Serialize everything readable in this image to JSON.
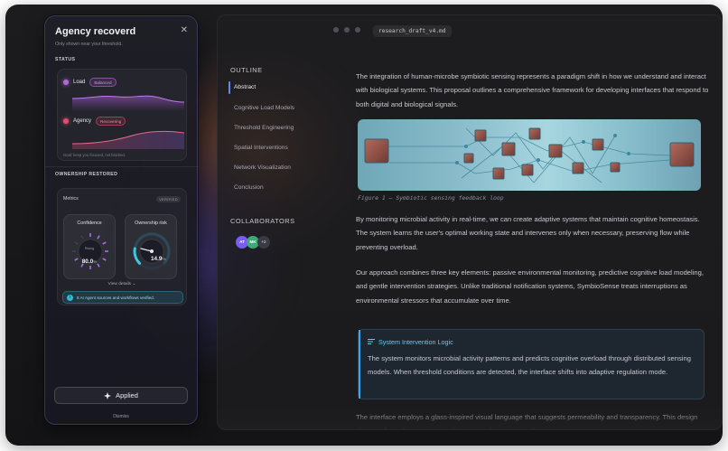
{
  "panel": {
    "title": "Agency recoverd",
    "subtitle": "Only shown near your threshold.",
    "status_label": "STATUS",
    "status": [
      {
        "name": "Load",
        "pill": "Balanced",
        "color": "#b06ad8"
      },
      {
        "name": "Agency",
        "pill": "Recovering",
        "color": "#e0506e"
      }
    ],
    "status_note": "Goal: keep you focused, not blocked.",
    "ownership_label": "OWNERSHIP RESTORED",
    "metrics_label": "Metrics",
    "verified_badge": "VERIFIED",
    "gauges": [
      {
        "title": "Confidence",
        "sub": "Rising",
        "value": "80.0",
        "unit": "%"
      },
      {
        "title": "Ownership risk",
        "value": "14.9",
        "unit": "%"
      }
    ],
    "view_details": "View details",
    "banner_text": "8 AI Agent sources and workflows verified.",
    "applied_label": "Applied",
    "dismiss_label": "Dismiss"
  },
  "window": {
    "file_tab": "research_draft_v4.md",
    "outline_title": "OUTLINE",
    "outline_items": [
      {
        "label": "Abstract"
      },
      {
        "label": "Cognitive Load Models"
      },
      {
        "label": "Threshold Engineering"
      },
      {
        "label": "Spatial Interventions"
      },
      {
        "label": "Network Visualization"
      },
      {
        "label": "Conclusion"
      }
    ],
    "collab_title": "COLLABORATORS",
    "collaborators": [
      {
        "initials": "AT",
        "color": "#7a5cf0"
      },
      {
        "initials": "MK",
        "color": "#3ea87a"
      },
      {
        "initials": "+2",
        "color": "#3a3a42"
      }
    ]
  },
  "doc": {
    "p1": "The integration of human-microbe symbiotic sensing represents a paradigm shift in how we understand and interact with biological systems. This proposal outlines a comprehensive framework for developing interfaces that respond to both digital and biological signals.",
    "caption": "Figure 1 — Symbiotic sensing feedback loop",
    "p2": "By monitoring microbial activity in real-time, we can create adaptive systems that maintain cognitive homeostasis. The system learns the user's optimal working state and intervenes only when necessary, preserving flow while preventing overload.",
    "p3": "Our approach combines three key elements: passive environmental monitoring, predictive cognitive load modeling, and gentle intervention strategies. Unlike traditional notification systems, SymbioSense treats interruptions as environmental stressors that accumulate over time.",
    "callout_title": "System Intervention Logic",
    "callout_text": "The system monitors microbial activity patterns and predicts cognitive overload through distributed sensing models. When threshold conditions are detected, the interface shifts into adaptive regulation mode.",
    "p4": "The interface employs a glass-inspired visual language that suggests permeability and transparency. This design choice reflects the semi-permeable nature of attention itself."
  }
}
